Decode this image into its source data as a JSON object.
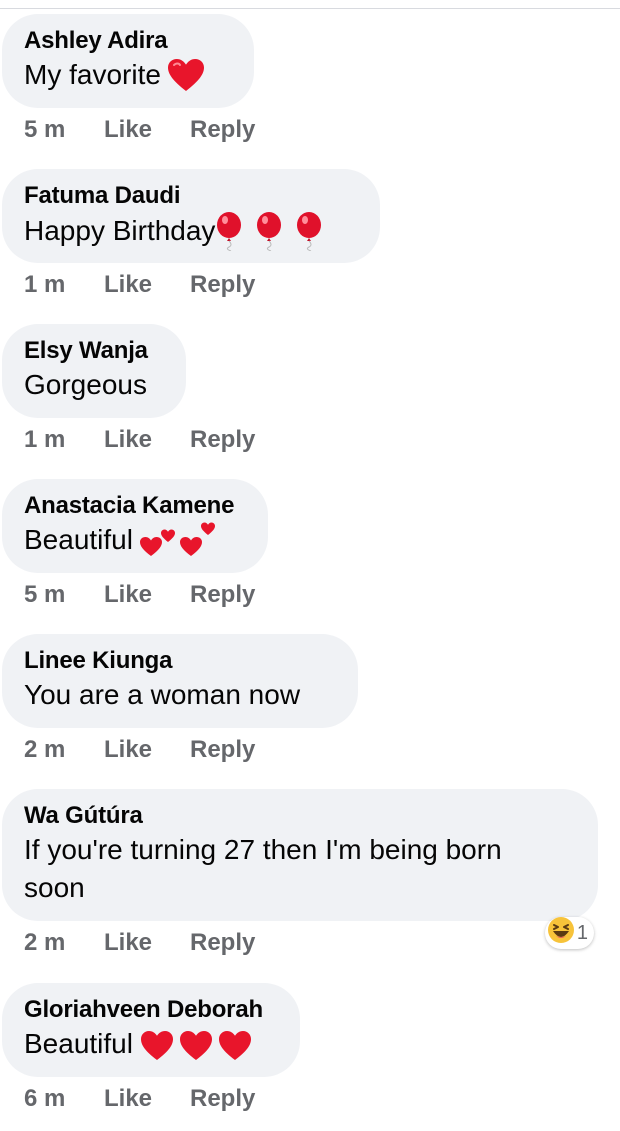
{
  "comments": [
    {
      "author": "Ashley Adira",
      "text": "My favorite",
      "emoji": "red-heart",
      "time": "5 m",
      "like": "Like",
      "reply": "Reply"
    },
    {
      "author": "Fatuma Daudi",
      "text": "Happy Birthday",
      "emoji": "balloons",
      "time": "1 m",
      "like": "Like",
      "reply": "Reply"
    },
    {
      "author": "Elsy Wanja",
      "text": "Gorgeous",
      "time": "1 m",
      "like": "Like",
      "reply": "Reply"
    },
    {
      "author": "Anastacia Kamene",
      "text": "Beautiful",
      "emoji": "two-hearts",
      "time": "5 m",
      "like": "Like",
      "reply": "Reply"
    },
    {
      "author": "Linee Kiunga",
      "text": "You are a woman now",
      "time": "2 m",
      "like": "Like",
      "reply": "Reply"
    },
    {
      "author": "Wa Gútúra",
      "text": "If you're turning 27 then I'm being born soon",
      "time": "2 m",
      "like": "Like",
      "reply": "Reply",
      "reaction": {
        "icon": "laughing-emoji",
        "count": "1"
      }
    },
    {
      "author": "Gloriahveen Deborah",
      "text": "Beautiful",
      "emoji": "three-hearts",
      "time": "6 m",
      "like": "Like",
      "reply": "Reply"
    }
  ],
  "colors": {
    "bubble": "#f0f2f5",
    "meta": "#65676b",
    "heart": "#e8152b"
  }
}
